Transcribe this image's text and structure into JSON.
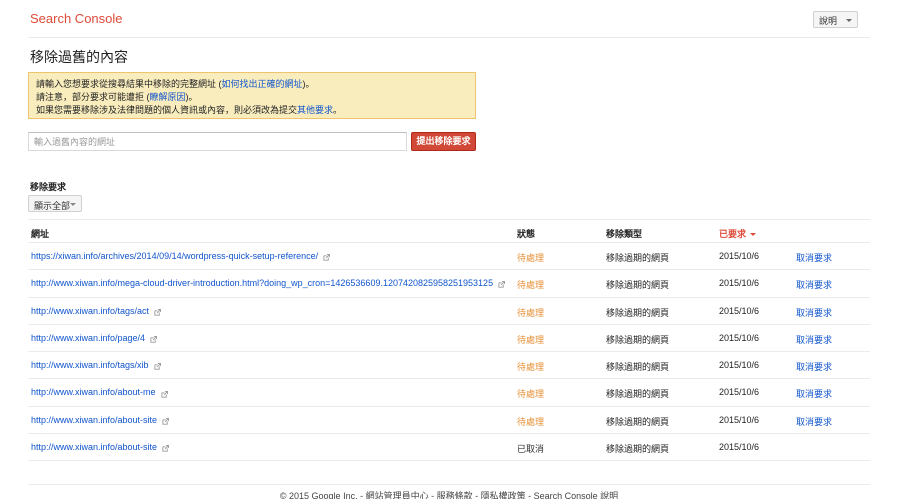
{
  "header": {
    "brand": "Search Console",
    "help_label": "說明"
  },
  "page": {
    "title": "移除過舊的內容"
  },
  "notice": {
    "line1_text": "請輸入您想要求從搜尋結果中移除的完整網址 (",
    "line1_link": "如何找出正確的網址",
    "line1_end": ")。",
    "line2_text": "請注意，部分要求可能遭拒 (",
    "line2_link": "瞭解原因",
    "line2_end": ")。",
    "line3_text": "如果您需要移除涉及法律問題的個人資訊或內容，則必須改為提交",
    "line3_link": "其他要求",
    "line3_end": "。"
  },
  "form": {
    "url_placeholder": "輸入過舊內容的網址",
    "submit_label": "提出移除要求"
  },
  "requests": {
    "section_label": "移除要求",
    "filter_label": "顯示全部",
    "columns": {
      "url": "網址",
      "status": "狀態",
      "type": "移除類型",
      "requested": "已要求"
    },
    "rows": [
      {
        "url": "https://xiwan.info/archives/2014/09/14/wordpress-quick-setup-reference/",
        "status": "待處理",
        "type": "移除過期的網頁",
        "date": "2015/10/6",
        "action": "取消要求"
      },
      {
        "url": "http://www.xiwan.info/mega-cloud-driver-introduction.html?doing_wp_cron=1426536609.1207420825958251953125",
        "status": "待處理",
        "type": "移除過期的網頁",
        "date": "2015/10/6",
        "action": "取消要求"
      },
      {
        "url": "http://www.xiwan.info/tags/act",
        "status": "待處理",
        "type": "移除過期的網頁",
        "date": "2015/10/6",
        "action": "取消要求"
      },
      {
        "url": "http://www.xiwan.info/page/4",
        "status": "待處理",
        "type": "移除過期的網頁",
        "date": "2015/10/6",
        "action": "取消要求"
      },
      {
        "url": "http://www.xiwan.info/tags/xib",
        "status": "待處理",
        "type": "移除過期的網頁",
        "date": "2015/10/6",
        "action": "取消要求"
      },
      {
        "url": "http://www.xiwan.info/about-me",
        "status": "待處理",
        "type": "移除過期的網頁",
        "date": "2015/10/6",
        "action": "取消要求"
      },
      {
        "url": "http://www.xiwan.info/about-site",
        "status": "待處理",
        "type": "移除過期的網頁",
        "date": "2015/10/6",
        "action": "取消要求"
      },
      {
        "url": "http://www.xiwan.info/about-site",
        "status": "已取消",
        "type": "移除過期的網頁",
        "date": "2015/10/6",
        "action": ""
      }
    ]
  },
  "footer": {
    "text": "© 2015 Google Inc. - 網站管理員中心 - 服務條款 - 隱私權政策 - Search Console 說明"
  },
  "colors": {
    "brand": "#dd4b39",
    "link": "#1155cc",
    "pending": "#e69138",
    "notice_bg": "#f9edbe",
    "submit_bg": "#d14836"
  }
}
